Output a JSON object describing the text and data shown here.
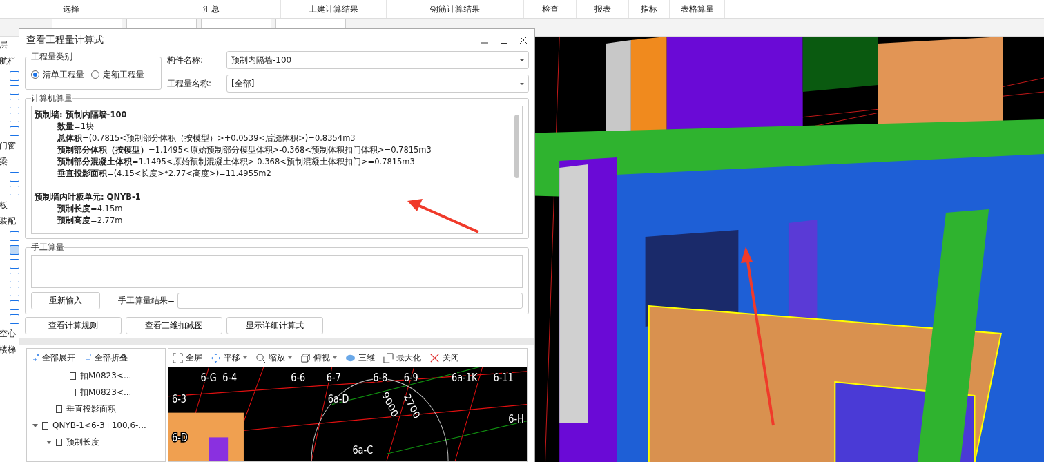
{
  "ribbon_tabs": [
    {
      "label": "选择"
    },
    {
      "label": "汇总"
    },
    {
      "label": "土建计算结果"
    },
    {
      "label": "钢筋计算结果"
    },
    {
      "label": "检查"
    },
    {
      "label": "报表"
    },
    {
      "label": "指标"
    },
    {
      "label": "表格算量"
    }
  ],
  "left_nav": [
    {
      "kind": "text",
      "label": "层"
    },
    {
      "kind": "text",
      "label": "航栏"
    },
    {
      "kind": "icon"
    },
    {
      "kind": "icon"
    },
    {
      "kind": "icon"
    },
    {
      "kind": "icon"
    },
    {
      "kind": "icon"
    },
    {
      "kind": "text",
      "label": "门窗"
    },
    {
      "kind": "text",
      "label": "梁"
    },
    {
      "kind": "icon"
    },
    {
      "kind": "icon"
    },
    {
      "kind": "text",
      "label": "板"
    },
    {
      "kind": "text",
      "label": "装配"
    },
    {
      "kind": "icon"
    },
    {
      "kind": "icon",
      "selected": true
    },
    {
      "kind": "icon"
    },
    {
      "kind": "icon"
    },
    {
      "kind": "icon"
    },
    {
      "kind": "icon"
    },
    {
      "kind": "icon"
    },
    {
      "kind": "text",
      "label": "空心"
    },
    {
      "kind": "text",
      "label": "楼梯"
    }
  ],
  "dialog": {
    "title": "查看工程量计算式",
    "quantity_type": {
      "legend": "工程量类别",
      "options": [
        {
          "label": "清单工程量",
          "selected": true
        },
        {
          "label": "定额工程量",
          "selected": false
        }
      ]
    },
    "fields": [
      {
        "label": "构件名称:",
        "value": "预制内隔墙-100"
      },
      {
        "label": "工程量名称:",
        "value": "[全部]"
      }
    ],
    "computer_calc": {
      "legend": "计算机算量",
      "lines": [
        {
          "kind": "heading",
          "text": "预制墙: 预制内隔墙-100"
        },
        {
          "kind": "item",
          "text": "**数量**=1块"
        },
        {
          "kind": "item",
          "text": "**总体积**=(0.7815<预制部分体积（按模型）>+0.0539<后浇体积>)=0.8354m3"
        },
        {
          "kind": "item",
          "text": "**预制部分体积（按模型）**=1.1495<原始预制部分模型体积>-0.368<预制体积扣门体积>=0.7815m3"
        },
        {
          "kind": "item",
          "text": "**预制部分混凝土体积**=1.1495<原始预制混凝土体积>-0.368<预制混凝土体积扣门>=0.7815m3"
        },
        {
          "kind": "item",
          "text": "**垂直投影面积**=(4.15<长度>*2.77<高度>)=11.4955m2"
        },
        {
          "kind": "blank"
        },
        {
          "kind": "heading",
          "text": "预制墙内叶板单元: QNYB-1"
        },
        {
          "kind": "item",
          "text": "**预制长度**=4.15m"
        },
        {
          "kind": "item",
          "text": "**预制高度**=2.77m"
        }
      ]
    },
    "manual_calc": {
      "legend": "手工算量",
      "reset_button": "重新输入",
      "result_label": "手工算量结果="
    },
    "buttons": [
      "查看计算规则",
      "查看三维扣减图",
      "显示详细计算式"
    ],
    "tree_toolbar": [
      "全部展开",
      "全部折叠"
    ],
    "tree": [
      {
        "children": [
          {
            "children": [
              {
                "label": "扣M0823<..."
              },
              {
                "label": "扣M0823<..."
              }
            ]
          },
          {
            "label": "垂直投影面积"
          }
        ]
      },
      {
        "label": "QNYB-1<6-3+100,6-...",
        "expanded": true,
        "children": [
          {
            "label": "预制长度",
            "expanded": true
          }
        ]
      }
    ],
    "view_toolbar": [
      {
        "kind": "fullscreen",
        "label": "全屏"
      },
      {
        "kind": "pan",
        "label": "平移",
        "dropdown": true
      },
      {
        "kind": "zoom",
        "label": "缩放",
        "dropdown": true
      },
      {
        "kind": "top",
        "label": "俯视",
        "dropdown": true
      },
      {
        "kind": "threed",
        "label": "三维"
      },
      {
        "kind": "maximize",
        "label": "最大化"
      },
      {
        "kind": "close",
        "label": "关闭"
      }
    ],
    "plan_labels": [
      "6-G",
      "6-4",
      "6-6",
      "6-7",
      "6-8",
      "6-9",
      "6a-1K",
      "6-11",
      "6-3",
      "6a-D",
      "2700",
      "9000",
      "6-H",
      "6-D",
      "6a-C"
    ]
  }
}
